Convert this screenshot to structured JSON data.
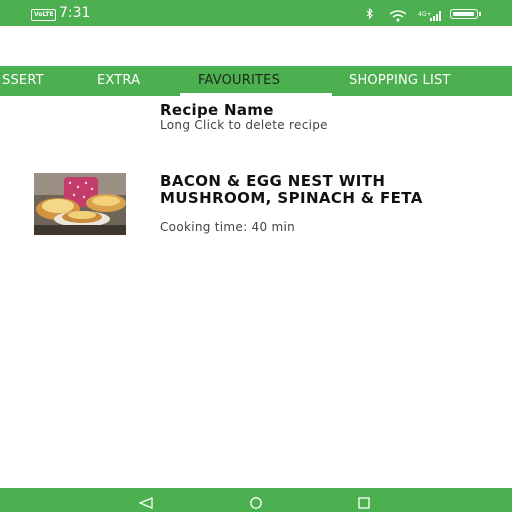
{
  "status_bar": {
    "carrier_badge": "VoLTE",
    "time": "7:31",
    "network": "4G+"
  },
  "tabs": [
    {
      "label": "SSERT",
      "active": false
    },
    {
      "label": "EXTRA",
      "active": false
    },
    {
      "label": "FAVOURITES",
      "active": true
    },
    {
      "label": "SHOPPING LIST",
      "active": false
    }
  ],
  "list": {
    "header_title": "Recipe Name",
    "header_hint": "Long Click to delete recipe",
    "items": [
      {
        "title": "BACON & EGG NEST WITH MUSHROOM, SPINACH & FETA",
        "cooking_time": "Cooking time: 40 min",
        "image": "recipe-photo-egg-nests"
      }
    ]
  },
  "nav": {
    "back": "back-icon",
    "home": "home-icon",
    "recents": "recents-icon"
  },
  "colors": {
    "primary": "#4caf50",
    "active_tab_text": "#1b2a1b",
    "indicator": "#ffffff"
  }
}
